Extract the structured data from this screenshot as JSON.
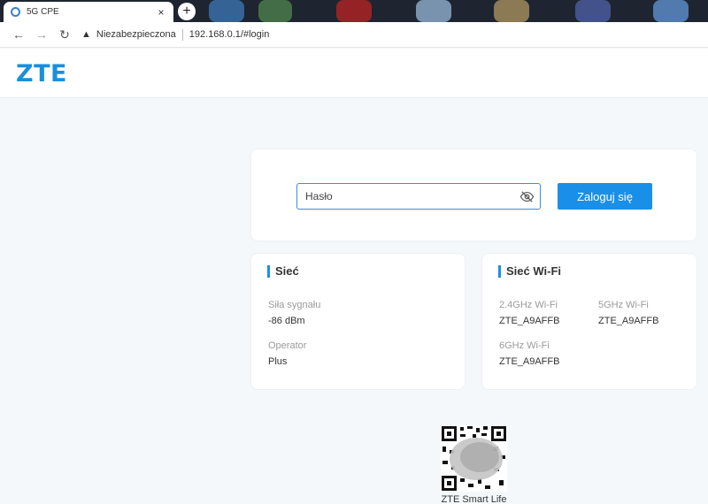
{
  "browser": {
    "tab_title": "5G CPE",
    "tab_close": "×",
    "new_tab": "+",
    "back": "←",
    "forward": "→",
    "reload": "↻",
    "security_warning": "Niezabezpieczona",
    "url": "192.168.0.1/#login"
  },
  "header": {
    "logo": "ZTE"
  },
  "login": {
    "password_placeholder": "Hasło",
    "password_value": "",
    "submit_label": "Zaloguj się"
  },
  "network": {
    "title": "Sieć",
    "fields": [
      {
        "label": "Siła sygnału",
        "value": "-86 dBm"
      },
      {
        "label": "Operator",
        "value": "Plus"
      }
    ]
  },
  "wifi": {
    "title": "Sieć Wi-Fi",
    "fields": [
      {
        "label": "2.4GHz Wi-Fi",
        "value": "ZTE_A9AFFB"
      },
      {
        "label": "5GHz Wi-Fi",
        "value": "ZTE_A9AFFB"
      },
      {
        "label": "6GHz Wi-Fi",
        "value": "ZTE_A9AFFB"
      }
    ]
  },
  "app": {
    "qr_label": "ZTE Smart Life"
  },
  "colors": {
    "accent": "#1a8fe8",
    "logo": "#1a8fdc",
    "background": "#f4f8fb"
  }
}
